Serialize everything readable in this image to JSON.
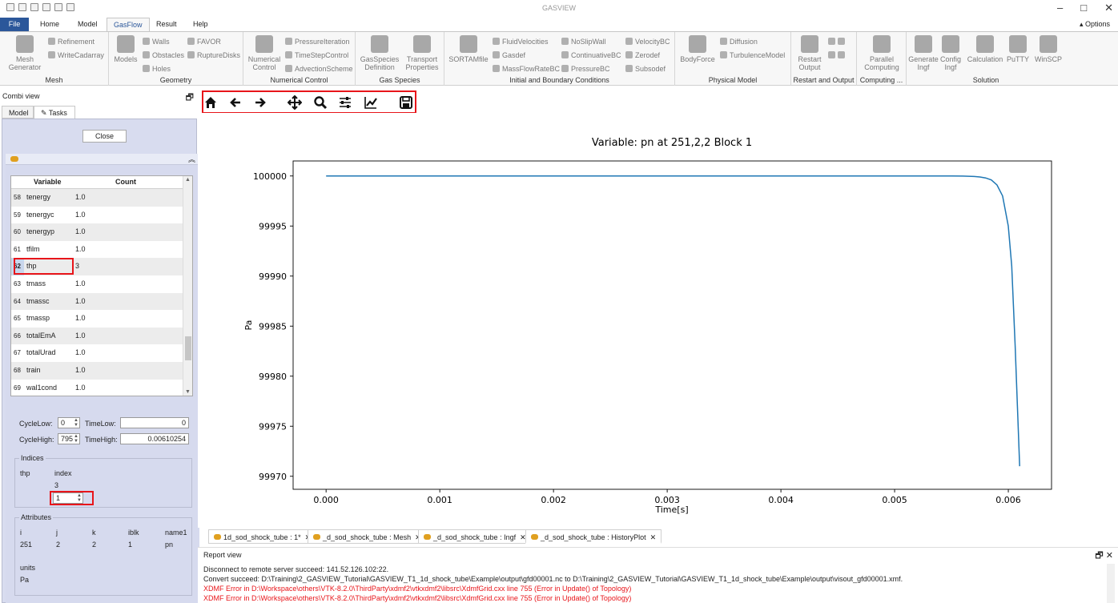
{
  "window": {
    "title": "GASVIEW"
  },
  "menu": {
    "tabs": [
      "File",
      "Home",
      "Model",
      "GasFlow",
      "Result",
      "Help"
    ],
    "active": "GasFlow",
    "options": "Options"
  },
  "ribbon": {
    "groups": [
      {
        "label": "Mesh",
        "big": [
          "Mesh\nGenerator"
        ],
        "small": [
          "Refinement",
          "WriteCadarray"
        ]
      },
      {
        "label": "Geometry",
        "big": [
          "Models"
        ],
        "small": [
          "Walls",
          "Obstacles",
          "Holes",
          "FAVOR",
          "RuptureDisks"
        ]
      },
      {
        "label": "Numerical Control",
        "big": [
          "Numerical\nControl"
        ],
        "small": [
          "PressureIteration",
          "TimeStepControl",
          "AdvectionScheme"
        ]
      },
      {
        "label": "Gas Species",
        "big": [
          "GasSpecies\nDefinition",
          "Transport\nProperties"
        ],
        "small": []
      },
      {
        "label": "Initial and Boundary Conditions",
        "big": [
          "SORTAMfile"
        ],
        "small": [
          "FluidVelocities",
          "Gasdef",
          "MassFlowRateBC",
          "NoSlipWall",
          "ContinuativeBC",
          "PressureBC",
          "VelocityBC",
          "Zerodef",
          "Subsodef"
        ]
      },
      {
        "label": "Physical Model",
        "big": [
          "BodyForce"
        ],
        "small": [
          "Diffusion",
          "TurbulenceModel"
        ]
      },
      {
        "label": "Restart and Output",
        "big": [
          "Restart\nOutput"
        ],
        "small": []
      },
      {
        "label": "Computing ...",
        "big": [
          "Parallel\nComputing"
        ],
        "small": []
      },
      {
        "label": "Solution",
        "big": [
          "Generate\nIngf",
          "Config\nIngf",
          "Calculation",
          "PuTTY",
          "WinSCP"
        ],
        "small": []
      }
    ]
  },
  "combi": {
    "title": "Combi view",
    "tabs": [
      "Model",
      "Tasks"
    ],
    "close_label": "Close",
    "table": {
      "headers": [
        "Variable",
        "Count"
      ],
      "rows": [
        {
          "n": "58",
          "var": "tenergy",
          "count": "1.0"
        },
        {
          "n": "59",
          "var": "tenergyc",
          "count": "1.0"
        },
        {
          "n": "60",
          "var": "tenergyp",
          "count": "1.0"
        },
        {
          "n": "61",
          "var": "tfilm",
          "count": "1.0"
        },
        {
          "n": "62",
          "var": "thp",
          "count": "3"
        },
        {
          "n": "63",
          "var": "tmass",
          "count": "1.0"
        },
        {
          "n": "64",
          "var": "tmassc",
          "count": "1.0"
        },
        {
          "n": "65",
          "var": "tmassp",
          "count": "1.0"
        },
        {
          "n": "66",
          "var": "totalEmA",
          "count": "1.0"
        },
        {
          "n": "67",
          "var": "totalUrad",
          "count": "1.0"
        },
        {
          "n": "68",
          "var": "train",
          "count": "1.0"
        },
        {
          "n": "69",
          "var": "wal1cond",
          "count": "1.0"
        }
      ]
    },
    "cycle_low_label": "CycleLow:",
    "cycle_low": "0",
    "time_low_label": "TimeLow:",
    "time_low": "0",
    "cycle_high_label": "CycleHigh:",
    "cycle_high": "795",
    "time_high_label": "TimeHigh:",
    "time_high": "0.00610254",
    "indices": {
      "legend": "Indices",
      "var": "thp",
      "col": "index",
      "count": "3",
      "value": "1"
    },
    "attributes": {
      "legend": "Attributes",
      "headers": [
        "i",
        "j",
        "k",
        "iblk",
        "name1"
      ],
      "values": [
        "251",
        "2",
        "2",
        "1",
        "pn"
      ],
      "units_label": "units",
      "units": "Pa"
    }
  },
  "chart_data": {
    "type": "line",
    "title": "Variable: pn at 251,2,2 Block 1",
    "xlabel": "Time[s]",
    "ylabel": "Pa",
    "xlim": [
      -0.00029,
      0.00638
    ],
    "ylim": [
      99968.7,
      100001.5
    ],
    "xticks": [
      0.0,
      0.001,
      0.002,
      0.003,
      0.004,
      0.005,
      0.006
    ],
    "xtick_labels": [
      "0.000",
      "0.001",
      "0.002",
      "0.003",
      "0.004",
      "0.005",
      "0.006"
    ],
    "yticks": [
      99970,
      99975,
      99980,
      99985,
      99990,
      99995,
      100000
    ],
    "ytick_labels": [
      "99970",
      "99975",
      "99980",
      "99985",
      "99990",
      "99995",
      "100000"
    ],
    "grid": false,
    "color": "#1f77b4",
    "series": [
      {
        "x": [
          0.0,
          0.001,
          0.002,
          0.003,
          0.004,
          0.005,
          0.0055,
          0.0056,
          0.0057,
          0.00575,
          0.0058,
          0.00585,
          0.0059,
          0.00595,
          0.006,
          0.00603,
          0.00606,
          0.0061
        ],
        "y": [
          100000,
          100000,
          100000,
          100000,
          100000,
          100000,
          100000,
          99999.99,
          99999.95,
          99999.9,
          99999.8,
          99999.6,
          99999.1,
          99998,
          99995,
          99991,
          99983,
          99971
        ]
      }
    ]
  },
  "doctabs": [
    "1d_sod_shock_tube : 1*",
    "_d_sod_shock_tube : Mesh",
    "_d_sod_shock_tube : Ingf",
    "_d_sod_shock_tube : HistoryPlot"
  ],
  "report": {
    "title": "Report view",
    "lines": [
      {
        "text": "Disconnect to remote server succeed: 141.52.126.102:22.",
        "err": false
      },
      {
        "text": "Convert succeed: D:\\Training\\2_GASVIEW_Tutorial\\GASVIEW_T1_1d_shock_tube\\Example\\output\\gfd00001.nc to D:\\Training\\2_GASVIEW_Tutorial\\GASVIEW_T1_1d_shock_tube\\Example\\output\\visout_gfd00001.xmf.",
        "err": false
      },
      {
        "text": "XDMF Error in D:\\Workspace\\others\\VTK-8.2.0\\ThirdParty\\xdmf2\\vtkxdmf2\\libsrc\\XdmfGrid.cxx line 755 (Error in Update() of Topology)",
        "err": true
      },
      {
        "text": "XDMF Error in D:\\Workspace\\others\\VTK-8.2.0\\ThirdParty\\xdmf2\\vtkxdmf2\\libsrc\\XdmfGrid.cxx line 755 (Error in Update() of Topology)",
        "err": true
      }
    ]
  }
}
